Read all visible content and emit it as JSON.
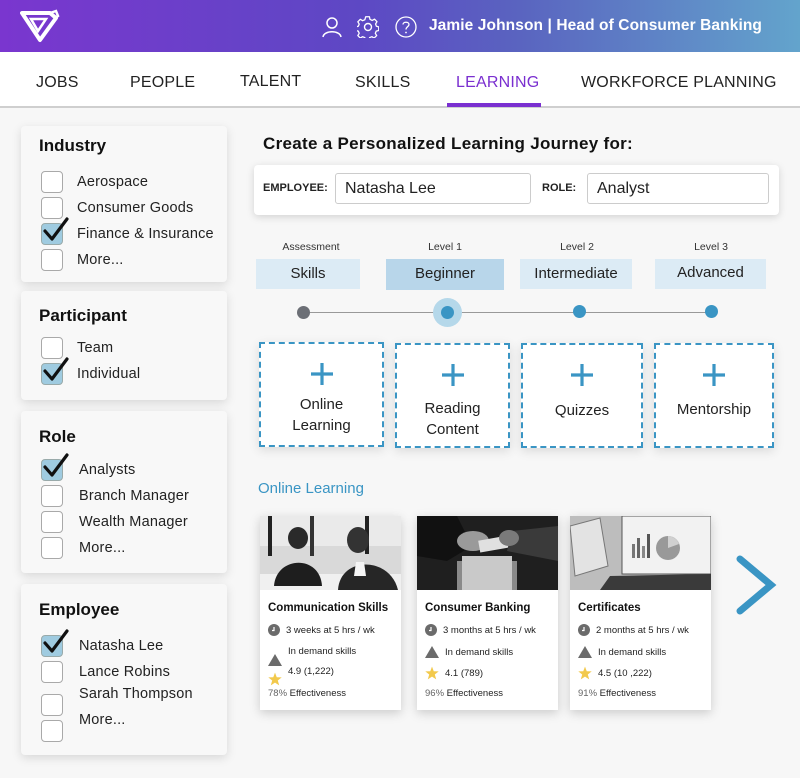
{
  "header": {
    "logo": "brand-logo",
    "icons": [
      "user-icon",
      "gear-icon",
      "help-icon"
    ],
    "user_title": "Jamie Johnson | Head of Consumer Banking"
  },
  "nav": {
    "tabs": [
      {
        "label": "JOBS",
        "active": false
      },
      {
        "label": "PEOPLE",
        "active": false
      },
      {
        "label": "TALENT",
        "active": false
      },
      {
        "label": "SKILLS",
        "active": false
      },
      {
        "label": "LEARNING",
        "active": true
      },
      {
        "label": "WORKFORCE PLANNING",
        "active": false
      }
    ],
    "active_color": "#7a2fd0"
  },
  "filters": {
    "industry": {
      "title": "Industry",
      "items": [
        {
          "label": "Aerospace",
          "checked": false
        },
        {
          "label": "Consumer Goods",
          "checked": false
        },
        {
          "label": "Finance & Insurance",
          "checked": true
        },
        {
          "label": "More...",
          "checked": false
        }
      ]
    },
    "participant": {
      "title": "Participant",
      "items": [
        {
          "label": "Team",
          "checked": false
        },
        {
          "label": "Individual",
          "checked": true
        }
      ]
    },
    "role": {
      "title": "Role",
      "items": [
        {
          "label": "Analysts",
          "checked": true
        },
        {
          "label": "Branch Manager",
          "checked": false
        },
        {
          "label": "Wealth Manager",
          "checked": false
        },
        {
          "label": "More...",
          "checked": false
        }
      ]
    },
    "employee": {
      "title": "Employee",
      "items": [
        {
          "label": "Natasha Lee",
          "checked": true
        },
        {
          "label": "Lance Robins",
          "checked": false
        },
        {
          "label": "Sarah Thompson",
          "checked": false
        },
        {
          "label": "More...",
          "checked": false
        }
      ]
    }
  },
  "main": {
    "title": "Create a Personalized Learning Journey for:",
    "employee_label": "EMPLOYEE:",
    "employee_value": "Natasha Lee",
    "role_label": "ROLE:",
    "role_value": "Analyst",
    "levels": [
      {
        "caption": "Assessment",
        "label": "Skills",
        "active": false,
        "completed": true
      },
      {
        "caption": "Level 1",
        "label": "Beginner",
        "active": true,
        "completed": false
      },
      {
        "caption": "Level 2",
        "label": "Intermediate",
        "active": false,
        "completed": false
      },
      {
        "caption": "Level 3",
        "label": "Advanced",
        "active": false,
        "completed": false
      }
    ],
    "add_cards": [
      {
        "icon": "plus-icon",
        "label_line1": "Online",
        "label_line2": "Learning"
      },
      {
        "icon": "plus-icon",
        "label_line1": "Reading",
        "label_line2": "Content"
      },
      {
        "icon": "plus-icon",
        "label_line1": "Quizzes",
        "label_line2": ""
      },
      {
        "icon": "plus-icon",
        "label_line1": "Mentorship",
        "label_line2": ""
      }
    ],
    "section_title": "Online Learning",
    "courses": [
      {
        "title": "Communication Skills",
        "duration": "3 weeks at 5 hrs / wk",
        "demand": "In demand skills",
        "rating": "4.9 (1,222)",
        "effectiveness_pct": "78%",
        "effectiveness_label": "Effectiveness",
        "image": "meeting-photo"
      },
      {
        "title": "Consumer Banking",
        "duration": "3 months at 5 hrs / wk",
        "demand": "In demand skills",
        "rating": "4.1 (789)",
        "effectiveness_pct": "96%",
        "effectiveness_label": "Effectiveness",
        "image": "card-payment-photo"
      },
      {
        "title": "Certificates",
        "duration": "2 months at 5 hrs / wk",
        "demand": "In demand skills",
        "rating": "4.5 (10 ,222)",
        "effectiveness_pct": "91%",
        "effectiveness_label": "Effectiveness",
        "image": "laptop-charts-photo"
      }
    ],
    "next_icon": "chevron-right-icon"
  },
  "colors": {
    "accent_blue": "#3a95c4",
    "level_bg": "#dcebf5",
    "level_active_bg": "#b8d6ea",
    "checkbox_checked": "#9fcbe0",
    "star": "#f2c94c"
  }
}
